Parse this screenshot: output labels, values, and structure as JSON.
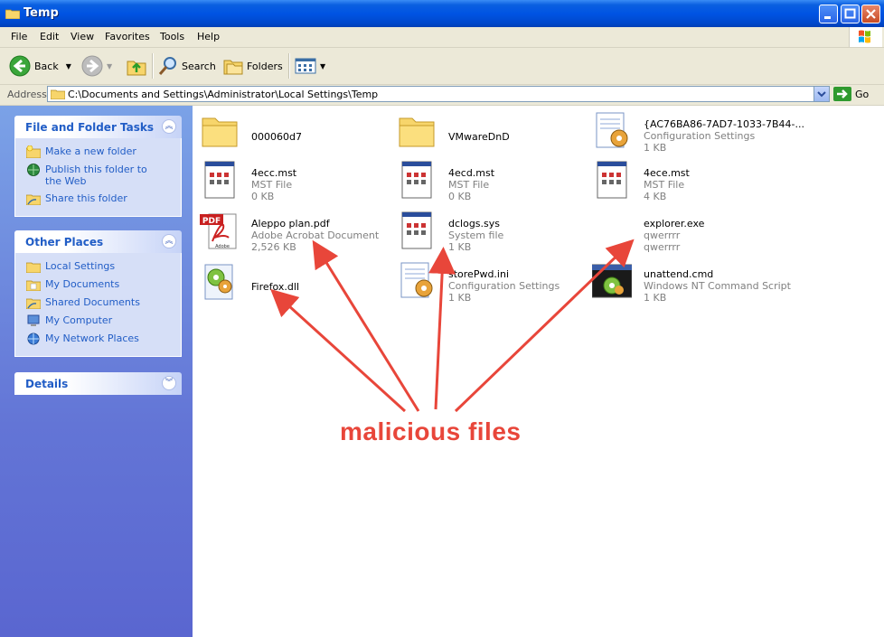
{
  "window": {
    "title": "Temp"
  },
  "menu": [
    "File",
    "Edit",
    "View",
    "Favorites",
    "Tools",
    "Help"
  ],
  "toolbar": {
    "back_label": "Back",
    "search_label": "Search",
    "folders_label": "Folders"
  },
  "address": {
    "label": "Address",
    "path": "C:\\Documents and Settings\\Administrator\\Local Settings\\Temp",
    "go_label": "Go"
  },
  "sidebar": {
    "file_tasks": {
      "title": "File and Folder Tasks",
      "items": [
        "Make a new folder",
        "Publish this folder to the Web",
        "Share this folder"
      ]
    },
    "other_places": {
      "title": "Other Places",
      "items": [
        "Local Settings",
        "My Documents",
        "Shared Documents",
        "My Computer",
        "My Network Places"
      ]
    },
    "details": {
      "title": "Details"
    }
  },
  "files": [
    {
      "name": "000060d7",
      "type": "",
      "size": "",
      "icon": "folder-icon"
    },
    {
      "name": "VMwareDnD",
      "type": "",
      "size": "",
      "icon": "folder-icon"
    },
    {
      "name": "{AC76BA86-7AD7-1033-7B44-...",
      "type": "Configuration Settings",
      "size": "1 KB",
      "icon": "config-settings-icon"
    },
    {
      "name": "4ecc.mst",
      "type": "MST File",
      "size": "0 KB",
      "icon": "mst-file-icon"
    },
    {
      "name": "4ecd.mst",
      "type": "MST File",
      "size": "0 KB",
      "icon": "mst-file-icon"
    },
    {
      "name": "4ece.mst",
      "type": "MST File",
      "size": "4 KB",
      "icon": "mst-file-icon"
    },
    {
      "name": "Aleppo plan.pdf",
      "type": "Adobe Acrobat Document",
      "size": "2,526 KB",
      "icon": "pdf-icon"
    },
    {
      "name": "dclogs.sys",
      "type": "System file",
      "size": "1 KB",
      "icon": "system-file-icon"
    },
    {
      "name": "explorer.exe",
      "type": "qwerrrr",
      "size": "qwerrrr",
      "icon": "blank-exe-icon"
    },
    {
      "name": "Firefox.dll",
      "type": "",
      "size": "",
      "icon": "dll-icon"
    },
    {
      "name": "storePwd.ini",
      "type": "Configuration Settings",
      "size": "1 KB",
      "icon": "config-settings-icon"
    },
    {
      "name": "unattend.cmd",
      "type": "Windows NT Command Script",
      "size": "1 KB",
      "icon": "cmd-script-icon"
    }
  ],
  "annotation": {
    "text": "malicious files",
    "color": "#e8463a"
  },
  "colors": {
    "title_bar": "#0054e3",
    "sidebar": "#6375d6",
    "link": "#215dc6",
    "chrome": "#ece9d8"
  }
}
